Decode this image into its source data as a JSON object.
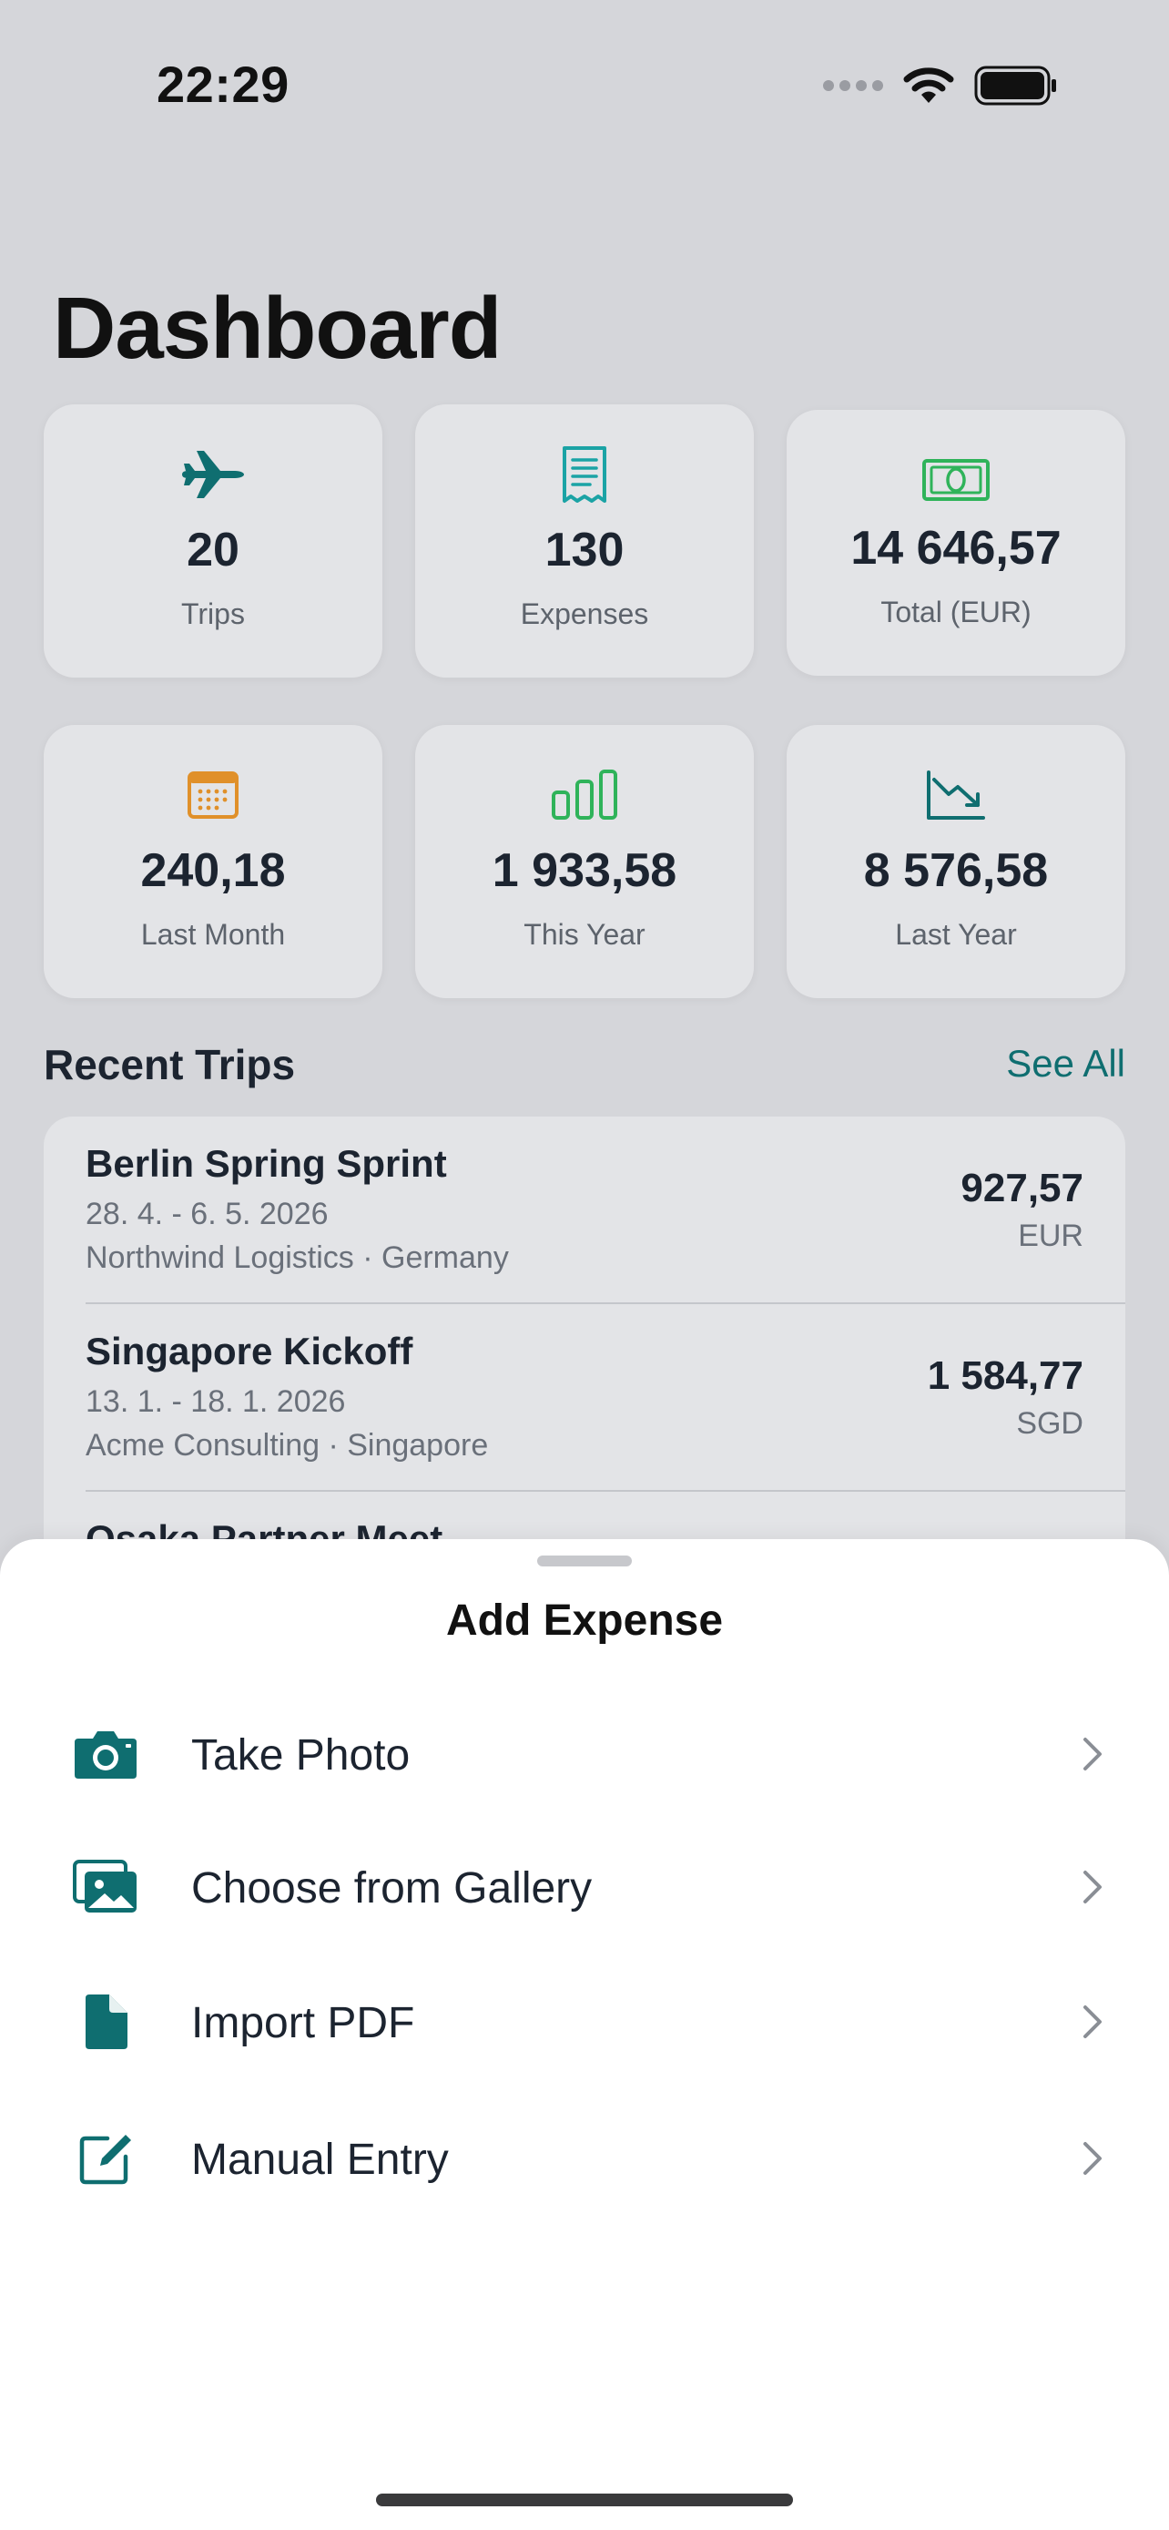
{
  "status_bar": {
    "time": "22:29"
  },
  "page": {
    "title": "Dashboard"
  },
  "stats": [
    {
      "value": "20",
      "label": "Trips",
      "icon": "airplane-icon",
      "color": "#0f6e70"
    },
    {
      "value": "130",
      "label": "Expenses",
      "icon": "receipt-icon",
      "color": "#1ba3a5"
    },
    {
      "value": "14 646,57",
      "label": "Total (EUR)",
      "icon": "banknote-icon",
      "color": "#2fb35a"
    },
    {
      "value": "240,18",
      "label": "Last Month",
      "icon": "calendar-icon",
      "color": "#e0902a"
    },
    {
      "value": "1 933,58",
      "label": "This Year",
      "icon": "bar-chart-icon",
      "color": "#2fb35a"
    },
    {
      "value": "8 576,58",
      "label": "Last Year",
      "icon": "trend-down-icon",
      "color": "#0f6e70"
    }
  ],
  "recent_trips": {
    "title": "Recent Trips",
    "see_all": "See All",
    "items": [
      {
        "name": "Berlin Spring Sprint",
        "dates": "28. 4. - 6. 5. 2026",
        "meta": "Northwind Logistics · Germany",
        "amount": "927,57",
        "currency": "EUR"
      },
      {
        "name": "Singapore Kickoff",
        "dates": "13. 1. - 18. 1. 2026",
        "meta": "Acme Consulting · Singapore",
        "amount": "1 584,77",
        "currency": "SGD"
      },
      {
        "name": "Osaka Partner Meet",
        "dates": "",
        "meta": "",
        "amount": "",
        "currency": ""
      }
    ]
  },
  "add_expense_sheet": {
    "title": "Add Expense",
    "options": [
      {
        "label": "Take Photo",
        "icon": "camera-icon"
      },
      {
        "label": "Choose from Gallery",
        "icon": "gallery-icon"
      },
      {
        "label": "Import PDF",
        "icon": "document-icon"
      },
      {
        "label": "Manual Entry",
        "icon": "edit-icon"
      }
    ]
  },
  "colors": {
    "accent": "#0f6e70",
    "background": "#d5d6da",
    "card": "#e3e4e7"
  }
}
